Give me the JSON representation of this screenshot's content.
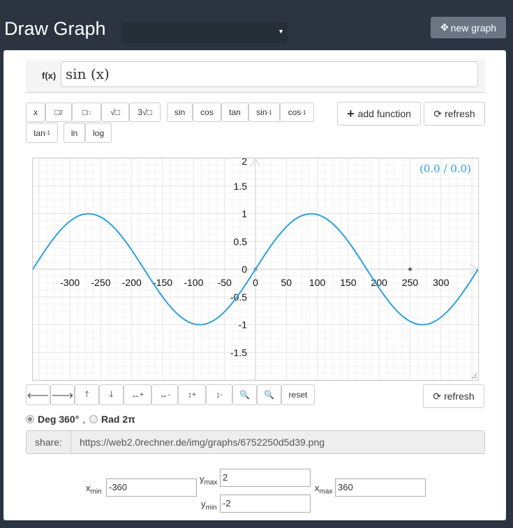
{
  "header": {
    "title": "Draw Graph",
    "select_value": "",
    "new_graph_label": "new graph"
  },
  "function": {
    "label": "f(x)",
    "value": "sin (x)"
  },
  "keypad": {
    "keys": [
      "x",
      "□2",
      "□□",
      "√□",
      "3√□",
      "sin",
      "cos",
      "tan",
      "sin-1",
      "cos-1",
      "tan-1",
      "ln",
      "log"
    ]
  },
  "actions": {
    "add_function": "add function",
    "refresh": "refresh"
  },
  "nav": {
    "reset": "reset",
    "refresh": "refresh"
  },
  "mode": {
    "deg": "Deg 360°",
    "rad": "Rad 2π",
    "selected": "deg"
  },
  "share": {
    "label": "share:",
    "url": "https://web2.0rechner.de/img/graphs/6752250d5d39.png"
  },
  "range": {
    "xmin_label": "x",
    "xmin_sub": "min",
    "xmin": "-360",
    "xmax_label": "x",
    "xmax_sub": "max",
    "xmax": "360",
    "ymin_label": "y",
    "ymin_sub": "min",
    "ymin": "-2",
    "ymax_label": "y",
    "ymax_sub": "max",
    "ymax": "2"
  },
  "chart_data": {
    "type": "line",
    "function": "sin(x)",
    "unit": "degrees",
    "xlim": [
      -360,
      360
    ],
    "ylim": [
      -2,
      2
    ],
    "x_ticks": [
      -300,
      -250,
      -200,
      -150,
      -100,
      -50,
      0,
      50,
      100,
      150,
      200,
      250,
      300
    ],
    "y_ticks": [
      2,
      1.5,
      1,
      0.5,
      0,
      -0.5,
      -1,
      -1.5
    ],
    "cursor_readout": "(0.0 / 0.0)",
    "markers": [
      {
        "x": 0,
        "y": 0
      },
      {
        "x": 250,
        "y": 0
      }
    ],
    "grid": true,
    "color": "#2ba0de"
  }
}
